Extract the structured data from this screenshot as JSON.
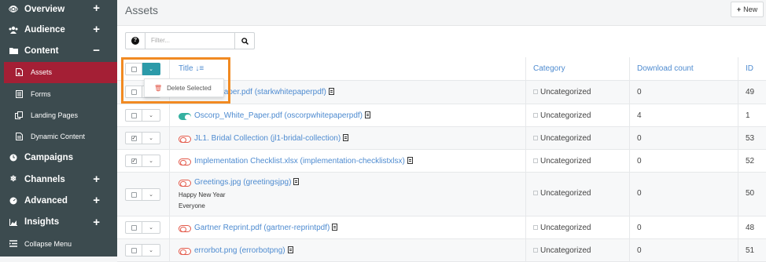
{
  "sidebar": {
    "items": [
      {
        "label": "Overview",
        "icon": "eye-icon",
        "expand": "+"
      },
      {
        "label": "Audience",
        "icon": "users-icon",
        "expand": "+"
      },
      {
        "label": "Content",
        "icon": "folder-icon",
        "expand": "−"
      },
      {
        "label": "Assets",
        "icon": "file-image-icon",
        "active": true
      },
      {
        "label": "Forms",
        "icon": "forms-icon"
      },
      {
        "label": "Landing Pages",
        "icon": "landing-pages-icon"
      },
      {
        "label": "Dynamic Content",
        "icon": "dynamic-content-icon"
      },
      {
        "label": "Campaigns",
        "icon": "clock-icon"
      },
      {
        "label": "Channels",
        "icon": "snowflake-icon",
        "expand": "+"
      },
      {
        "label": "Advanced",
        "icon": "tachometer-icon",
        "expand": "+"
      },
      {
        "label": "Insights",
        "icon": "chart-icon",
        "expand": "+"
      },
      {
        "label": "Collapse Menu",
        "icon": "collapse-icon"
      }
    ]
  },
  "header": {
    "title": "Assets",
    "new_label": "New",
    "new_icon": "+"
  },
  "filter": {
    "help_icon": "?",
    "placeholder": "Filter..."
  },
  "table": {
    "columns": {
      "title": "Title",
      "category": "Category",
      "downloads": "Download count",
      "id": "ID"
    },
    "bulk_menu": {
      "delete_label": "Delete Selected"
    },
    "rows": [
      {
        "title": "White_Paper.pdf (starkwhitepaperpdf)",
        "category": "Uncategorized",
        "downloads": "0",
        "id": "49",
        "checked": false,
        "published": false,
        "file": "pdf"
      },
      {
        "title": "Oscorp_White_Paper.pdf (oscorpwhitepaperpdf)",
        "category": "Uncategorized",
        "downloads": "4",
        "id": "1",
        "checked": false,
        "published": true,
        "file": "pdf"
      },
      {
        "title": "JL1. Bridal Collection (jl1-bridal-collection)",
        "category": "Uncategorized",
        "downloads": "0",
        "id": "53",
        "checked": true,
        "published": false,
        "file": "pdf"
      },
      {
        "title": "Implementation Checklist.xlsx (implementation-checklistxlsx)",
        "category": "Uncategorized",
        "downloads": "0",
        "id": "52",
        "checked": true,
        "published": false,
        "file": "xls"
      },
      {
        "title": "Greetings.jpg (greetingsjpg)",
        "meta1": "Happy New Year",
        "meta2": "Everyone",
        "category": "Uncategorized",
        "downloads": "0",
        "id": "50",
        "checked": false,
        "published": false,
        "file": "img"
      },
      {
        "title": "Gartner Reprint.pdf (gartner-reprintpdf)",
        "category": "Uncategorized",
        "downloads": "0",
        "id": "48",
        "checked": false,
        "published": false,
        "file": "pdf"
      },
      {
        "title": "errorbot.png (errorbotpng)",
        "category": "Uncategorized",
        "downloads": "0",
        "id": "51",
        "checked": false,
        "published": false,
        "file": "img"
      }
    ]
  },
  "colors": {
    "sidebar": "#3c4b4f",
    "active": "#a41f35",
    "link": "#4e8bd0",
    "highlight": "#f18a22",
    "toggle_on": "#35b1a1",
    "toggle_off": "#e35a4b"
  }
}
